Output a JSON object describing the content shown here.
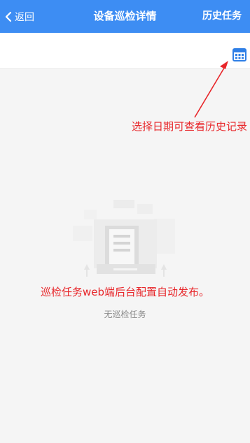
{
  "header": {
    "back_label": "返回",
    "title": "设备巡检详情",
    "history_label": "历史任务",
    "background_color": "#3d8df3"
  },
  "toolbar": {
    "calendar_icon": "calendar-icon"
  },
  "annotations": {
    "calendar_hint": "选择日期可查看历史记录",
    "config_hint": "巡检任务web端后台配置自动发布。",
    "color": "#e8262a"
  },
  "empty_state": {
    "illustration_icon": "empty-document-icon",
    "message": "无巡检任务"
  }
}
